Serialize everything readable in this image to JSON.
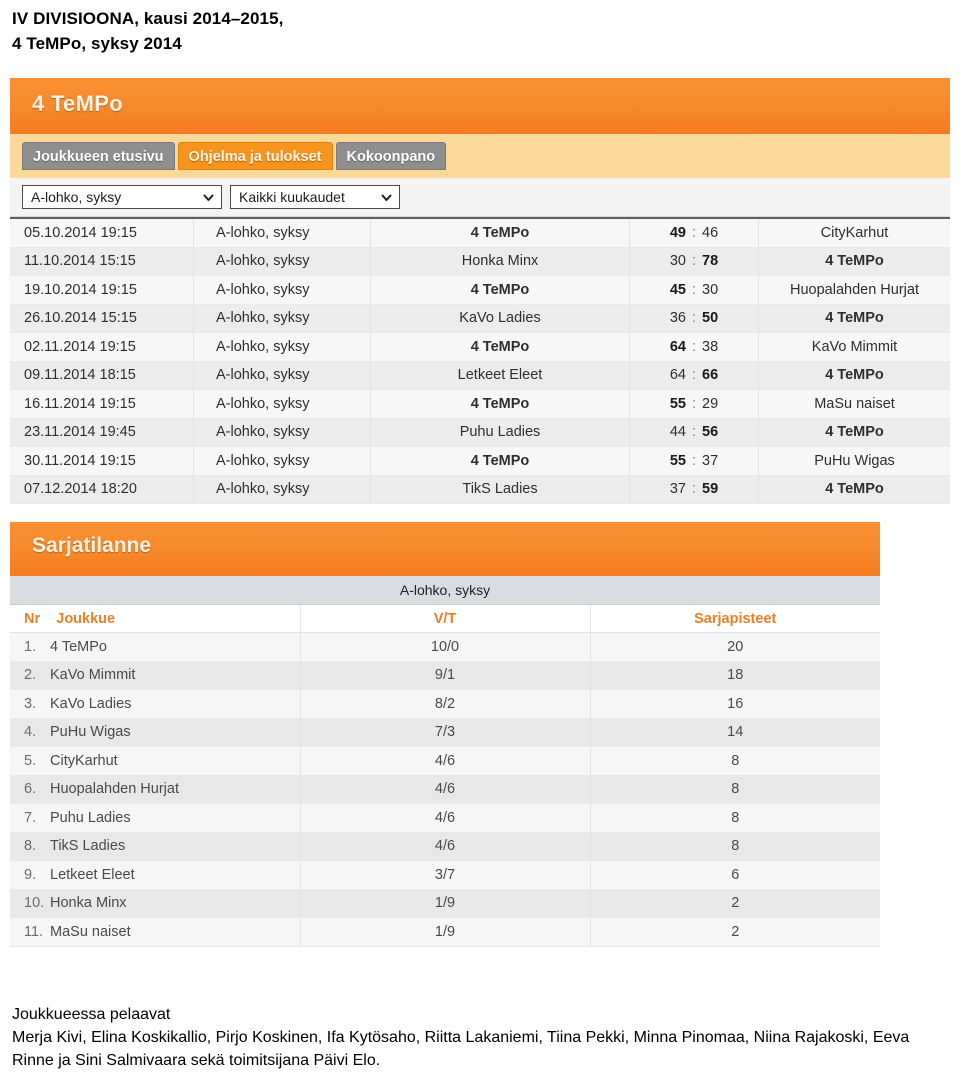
{
  "heading": {
    "line1": "IV DIVISIOONA, kausi 2014–2015,",
    "line2": "4 TeMPo, syksy 2014"
  },
  "club": {
    "banner_title": "4 TeMPo",
    "tabs": [
      {
        "label": "Joukkueen etusivu",
        "active": false
      },
      {
        "label": "Ohjelma ja tulokset",
        "active": true
      },
      {
        "label": "Kokoonpano",
        "active": false
      }
    ],
    "filters": {
      "group_select": "A-lohko, syksy",
      "month_select": "Kaikki kuukaudet",
      "caret_icon": "chevron-down-icon"
    }
  },
  "matches": [
    {
      "date": "05.10.2014 19:15",
      "group": "A-lohko, syksy",
      "home": "4 TeMPo",
      "home_bold": true,
      "score_home": "49",
      "score_away": "46",
      "home_score_bold": true,
      "away_score_bold": false,
      "away": "CityKarhut",
      "away_bold": false
    },
    {
      "date": "11.10.2014 15:15",
      "group": "A-lohko, syksy",
      "home": "Honka Minx",
      "home_bold": false,
      "score_home": "30",
      "score_away": "78",
      "home_score_bold": false,
      "away_score_bold": true,
      "away": "4 TeMPo",
      "away_bold": true
    },
    {
      "date": "19.10.2014 19:15",
      "group": "A-lohko, syksy",
      "home": "4 TeMPo",
      "home_bold": true,
      "score_home": "45",
      "score_away": "30",
      "home_score_bold": true,
      "away_score_bold": false,
      "away": "Huopalahden Hurjat",
      "away_bold": false
    },
    {
      "date": "26.10.2014 15:15",
      "group": "A-lohko, syksy",
      "home": "KaVo Ladies",
      "home_bold": false,
      "score_home": "36",
      "score_away": "50",
      "home_score_bold": false,
      "away_score_bold": true,
      "away": "4 TeMPo",
      "away_bold": true
    },
    {
      "date": "02.11.2014 19:15",
      "group": "A-lohko, syksy",
      "home": "4 TeMPo",
      "home_bold": true,
      "score_home": "64",
      "score_away": "38",
      "home_score_bold": true,
      "away_score_bold": false,
      "away": "KaVo Mimmit",
      "away_bold": false
    },
    {
      "date": "09.11.2014 18:15",
      "group": "A-lohko, syksy",
      "home": "Letkeet Eleet",
      "home_bold": false,
      "score_home": "64",
      "score_away": "66",
      "home_score_bold": false,
      "away_score_bold": true,
      "away": "4 TeMPo",
      "away_bold": true
    },
    {
      "date": "16.11.2014 19:15",
      "group": "A-lohko, syksy",
      "home": "4 TeMPo",
      "home_bold": true,
      "score_home": "55",
      "score_away": "29",
      "home_score_bold": true,
      "away_score_bold": false,
      "away": "MaSu naiset",
      "away_bold": false
    },
    {
      "date": "23.11.2014 19:45",
      "group": "A-lohko, syksy",
      "home": "Puhu Ladies",
      "home_bold": false,
      "score_home": "44",
      "score_away": "56",
      "home_score_bold": false,
      "away_score_bold": true,
      "away": "4 TeMPo",
      "away_bold": true
    },
    {
      "date": "30.11.2014 19:15",
      "group": "A-lohko, syksy",
      "home": "4 TeMPo",
      "home_bold": true,
      "score_home": "55",
      "score_away": "37",
      "home_score_bold": true,
      "away_score_bold": false,
      "away": "PuHu Wigas",
      "away_bold": false
    },
    {
      "date": "07.12.2014 18:20",
      "group": "A-lohko, syksy",
      "home": "TikS Ladies",
      "home_bold": false,
      "score_home": "37",
      "score_away": "59",
      "home_score_bold": false,
      "away_score_bold": true,
      "away": "4 TeMPo",
      "away_bold": true
    }
  ],
  "standings": {
    "banner_title": "Sarjatilanne",
    "group_label": "A-lohko, syksy",
    "columns": {
      "nr": "Nr",
      "team": "Joukkue",
      "vt": "V/T",
      "points": "Sarjapisteet"
    },
    "rows": [
      {
        "rank": "1.",
        "team": "4 TeMPo",
        "vt": "10/0",
        "points": "20"
      },
      {
        "rank": "2.",
        "team": "KaVo Mimmit",
        "vt": "9/1",
        "points": "18"
      },
      {
        "rank": "3.",
        "team": "KaVo Ladies",
        "vt": "8/2",
        "points": "16"
      },
      {
        "rank": "4.",
        "team": "PuHu Wigas",
        "vt": "7/3",
        "points": "14"
      },
      {
        "rank": "5.",
        "team": "CityKarhut",
        "vt": "4/6",
        "points": "8"
      },
      {
        "rank": "6.",
        "team": "Huopalahden Hurjat",
        "vt": "4/6",
        "points": "8"
      },
      {
        "rank": "7.",
        "team": "Puhu Ladies",
        "vt": "4/6",
        "points": "8"
      },
      {
        "rank": "8.",
        "team": "TikS Ladies",
        "vt": "4/6",
        "points": "8"
      },
      {
        "rank": "9.",
        "team": "Letkeet Eleet",
        "vt": "3/7",
        "points": "6"
      },
      {
        "rank": "10.",
        "team": "Honka Minx",
        "vt": "1/9",
        "points": "2"
      },
      {
        "rank": "11.",
        "team": "MaSu naiset",
        "vt": "1/9",
        "points": "2"
      }
    ]
  },
  "note": {
    "line1": "Joukkueessa pelaavat",
    "line2": "Merja Kivi, Elina Koskikallio, Pirjo Koskinen, Ifa Kytösaho, Riitta Lakaniemi, Tiina Pekki, Minna Pinomaa, Niina Rajakoski, Eeva Rinne ja Sini Salmivaara sekä toimitsijana Päivi Elo."
  },
  "colors": {
    "orange": "#f57b20",
    "orange_light": "#f99034",
    "peach": "#fcd999",
    "tab_gray": "#8e8e8e",
    "header_text_orange": "#e8802a"
  }
}
